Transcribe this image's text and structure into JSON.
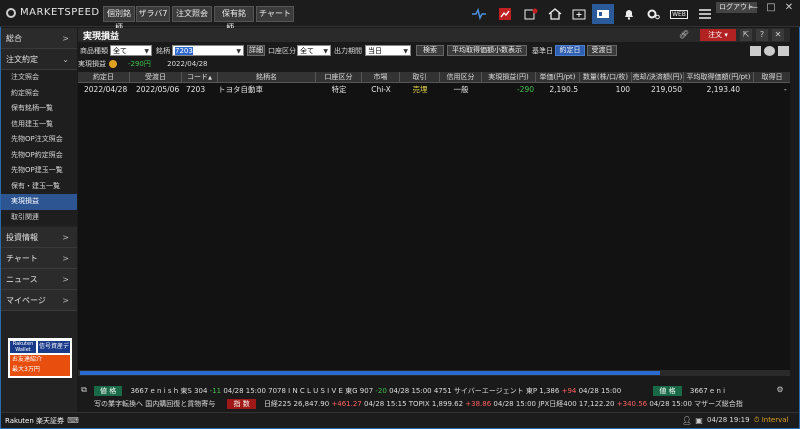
{
  "app": {
    "logo": "MARKETSPEED II",
    "logout": "ログアウト"
  },
  "top_tabs": [
    "個別銘柄",
    "ザラバ7",
    "注文照会",
    "保有銘柄...",
    "チャート"
  ],
  "top_icons": [
    "pulse-icon",
    "chart-alert-icon",
    "news-icon",
    "home-icon",
    "new-window-icon",
    "layout-icon",
    "bell-icon",
    "settings-icon",
    "web-icon",
    "menu-icon"
  ],
  "top_web_label": "WEB",
  "sidebar": {
    "sections": [
      {
        "label": "総合"
      },
      {
        "label": "注文約定"
      }
    ],
    "sub_items": [
      "注文照会",
      "約定照会",
      "保有銘柄一覧",
      "信用建玉一覧",
      "先物OP注文照会",
      "先物OP約定照会",
      "先物OP建玉一覧",
      "保有・建玉一覧",
      "実現損益",
      "取引関連"
    ],
    "active_index": 8,
    "bottom_sections": [
      "投資情報",
      "チャート",
      "ニュース",
      "マイページ"
    ],
    "banner": {
      "line1": "Rakuten Wallet",
      "line2": "信号資産デビュー",
      "line3": "お友達紹介",
      "amount": "最大3万円"
    }
  },
  "panel": {
    "title": "実現損益",
    "order_button": "注文",
    "question": "?"
  },
  "filter": {
    "product_label": "商品種類",
    "product_value": "全て",
    "symbol_label": "銘柄",
    "symbol_value": "7203",
    "detail_button": "詳細",
    "account_label": "口座区分",
    "account_value": "全て",
    "period_label": "出力期間",
    "period_value": "当日",
    "search_button": "検索",
    "avg_button": "平均取得価額小数表示",
    "base_label": "基準日",
    "trade_date_button": "約定日",
    "delivery_date_button": "受渡日"
  },
  "summary": {
    "label": "実現損益",
    "value": "-290円",
    "date": "2022/04/28"
  },
  "table": {
    "headers": [
      "約定日",
      "受渡日",
      "コード",
      "銘柄名",
      "口座区分",
      "市場",
      "取引",
      "信用区分",
      "実現損益(円)",
      "単価(円/pt)",
      "数量(株/口/枚)",
      "売却/決済額(円)",
      "平均取得価額(円/pt)",
      "取得日"
    ],
    "sort_arrow": "▲",
    "rows": [
      {
        "trade_date": "2022/04/28",
        "delivery_date": "2022/05/06",
        "code": "7203",
        "name": "トヨタ自動車",
        "account": "特定",
        "market": "Chi-X",
        "trade": "売埋",
        "credit": "一般",
        "pnl": "-290",
        "price": "2,190.5",
        "qty": "100",
        "amount": "219,050",
        "avg_cost": "2,193.40",
        "acq": "-"
      }
    ]
  },
  "ticker": {
    "line1": [
      {
        "tag": "値 格"
      },
      {
        "text": "3667 e n i s h 東S 304"
      },
      {
        "change": "-11",
        "dir": "dn"
      },
      {
        "text": "04/28 15:00   7078 I N C L U S I V E 東G 907"
      },
      {
        "change": "-20",
        "dir": "dn"
      },
      {
        "text": "04/28 15:00   4751 サイバーエージェント 東P 1,386"
      },
      {
        "change": "+94",
        "dir": "up"
      },
      {
        "text": "04/28 15:00"
      },
      {
        "tag": "値 格"
      },
      {
        "text": "3667 e n i"
      }
    ],
    "line2": [
      {
        "text": "写の業字転換へ  国内購回復と貨物寄与"
      },
      {
        "tag": "指 数",
        "red": true
      },
      {
        "text": "日経225 26,847.90"
      },
      {
        "change": "+461.27",
        "dir": "up"
      },
      {
        "text": "04/28 15:15   TOPIX 1,899.62"
      },
      {
        "change": "+38.86",
        "dir": "up"
      },
      {
        "text": "04/28 15:00   JPX日経400 17,122.20"
      },
      {
        "change": "+340.56",
        "dir": "up"
      },
      {
        "text": "04/28 15:00   マザーズ総合指"
      }
    ]
  },
  "status": {
    "brand": "Rakuten 楽天証券",
    "datetime": "04/28 19:19",
    "interval": "Interval"
  },
  "colors": {
    "accent": "#2d5592",
    "profit_negative": "#3fc24a",
    "sell": "#e8d84a",
    "order": "#b22222"
  }
}
